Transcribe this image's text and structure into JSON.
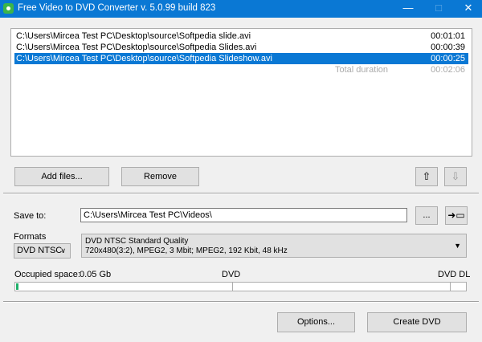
{
  "window": {
    "title": "Free Video to DVD Converter  v. 5.0.99 build 823"
  },
  "files": [
    {
      "path": "C:\\Users\\Mircea Test PC\\Desktop\\source\\Softpedia slide.avi",
      "duration": "00:01:01",
      "selected": false
    },
    {
      "path": "C:\\Users\\Mircea Test PC\\Desktop\\source\\Softpedia Slides.avi",
      "duration": "00:00:39",
      "selected": false
    },
    {
      "path": "C:\\Users\\Mircea Test PC\\Desktop\\source\\Softpedia Slideshow.avi",
      "duration": "00:00:25",
      "selected": true
    }
  ],
  "total": {
    "label": "Total duration",
    "value": "00:02:06"
  },
  "buttons": {
    "add": "Add files...",
    "remove": "Remove",
    "browse": "...",
    "options": "Options...",
    "create": "Create DVD",
    "up_icon": "arrow-up-icon",
    "down_icon": "arrow-down-icon",
    "open_icon": "open-folder-icon"
  },
  "save": {
    "label": "Save to:",
    "value": "C:\\Users\\Mircea Test PC\\Videos\\"
  },
  "formats": {
    "label": "Formats",
    "selected": "DVD NTSC",
    "quality_title": "DVD NTSC Standard Quality",
    "quality_detail": "720x480(3:2), MPEG2, 3 Mbit; MPEG2, 192 Kbit, 48 kHz"
  },
  "space": {
    "label": "Occupied space:",
    "value": "0.05 Gb",
    "dvd": "DVD",
    "dvddl": "DVD DL",
    "fill_percent": 0.5,
    "fill_color": "#1fb06a"
  },
  "colors": {
    "accent": "#0a78d4"
  }
}
